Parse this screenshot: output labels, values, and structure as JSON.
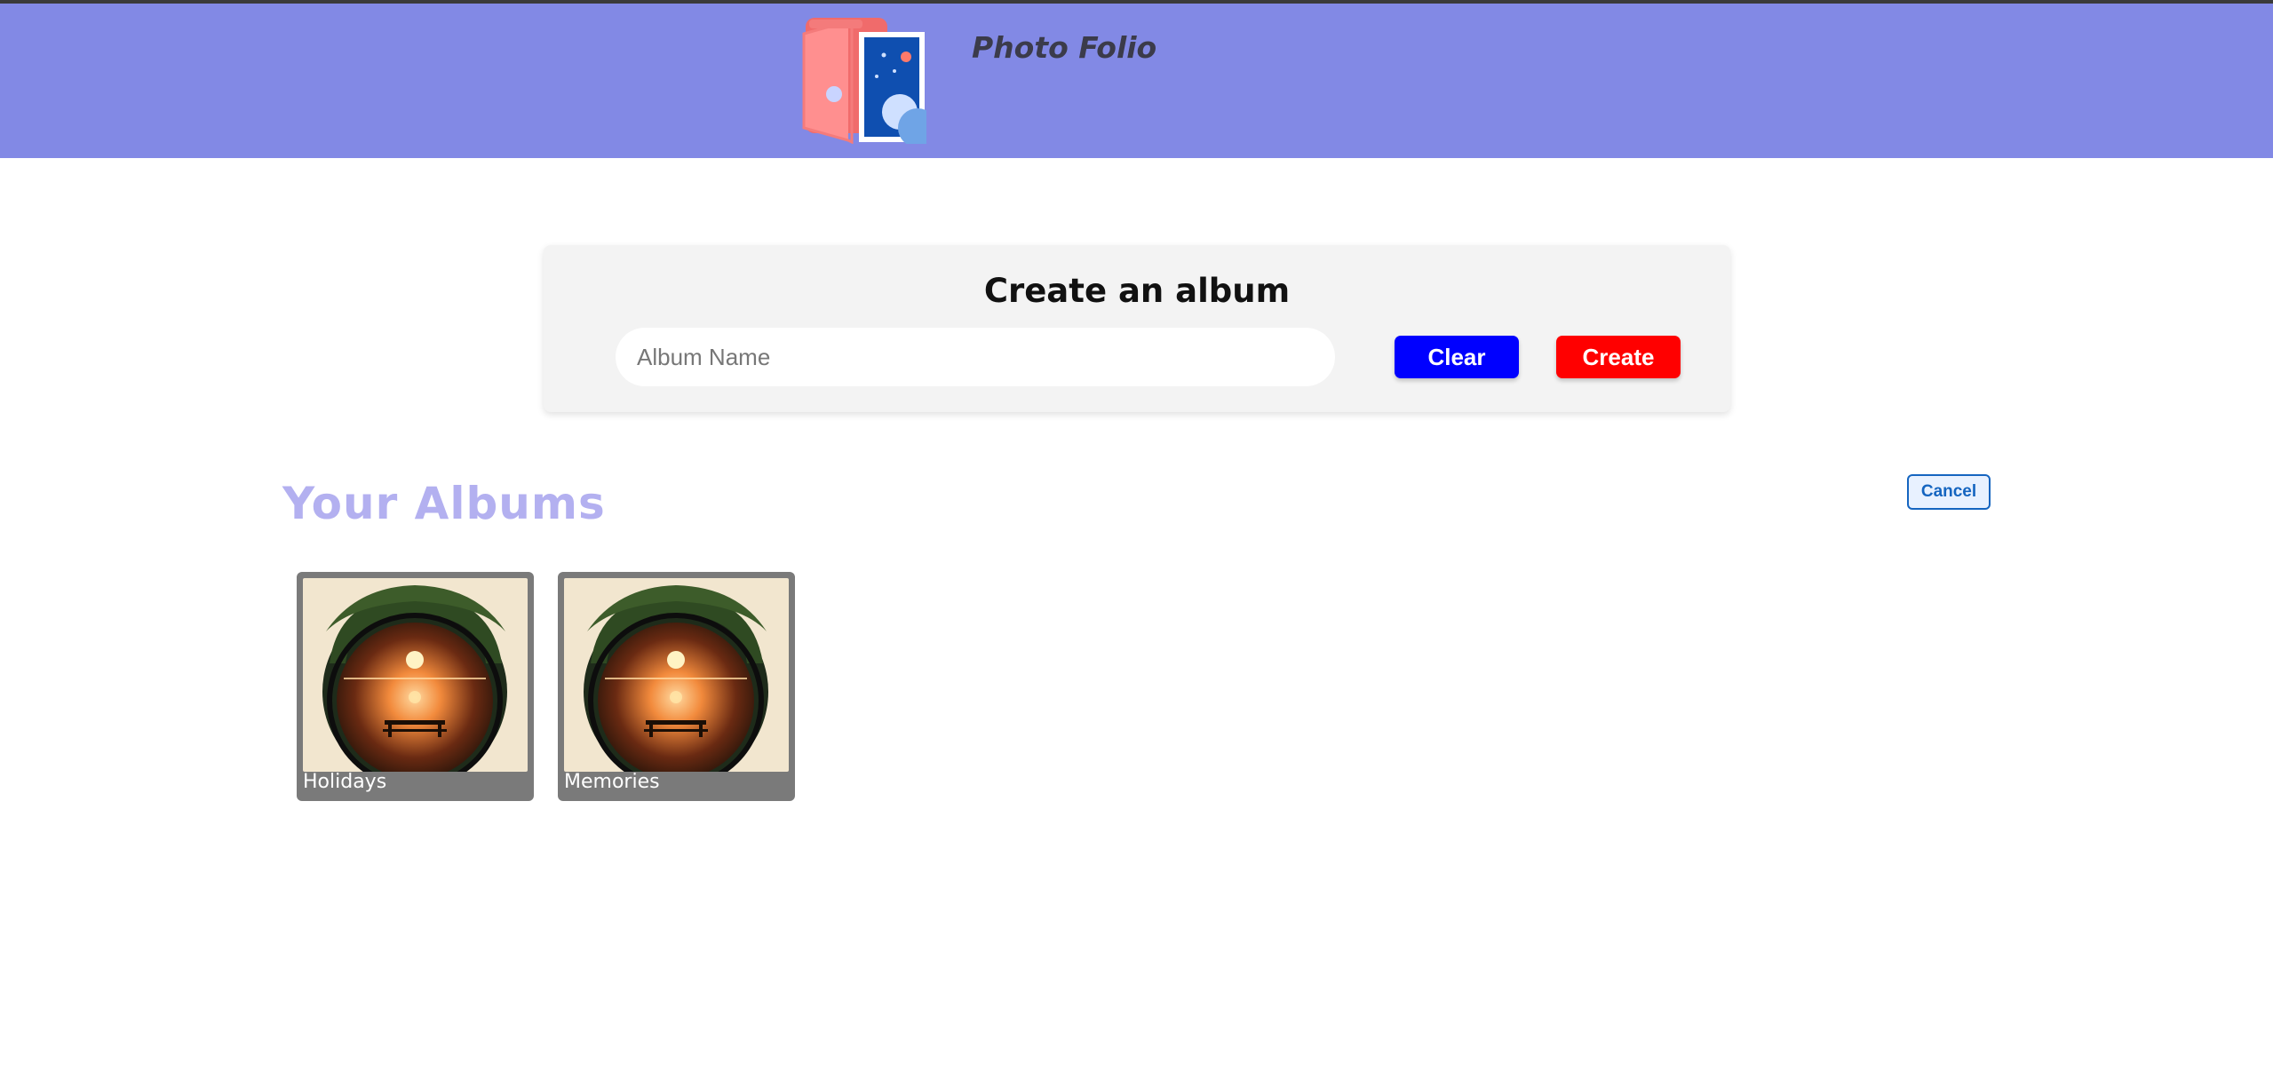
{
  "header": {
    "brand": "Photo Folio",
    "logo_icon": "photo-album-icon",
    "background_color": "#8289e5"
  },
  "create_album": {
    "title": "Create an album",
    "input_placeholder": "Album Name",
    "input_value": "",
    "clear_label": "Clear",
    "create_label": "Create",
    "clear_color": "#0000ff",
    "create_color": "#ff0000"
  },
  "albums_section": {
    "heading": "Your Albums",
    "cancel_label": "Cancel",
    "albums": [
      {
        "name": "Holidays",
        "thumbnail_icon": "sunset-bench-image"
      },
      {
        "name": "Memories",
        "thumbnail_icon": "sunset-bench-image"
      }
    ]
  }
}
